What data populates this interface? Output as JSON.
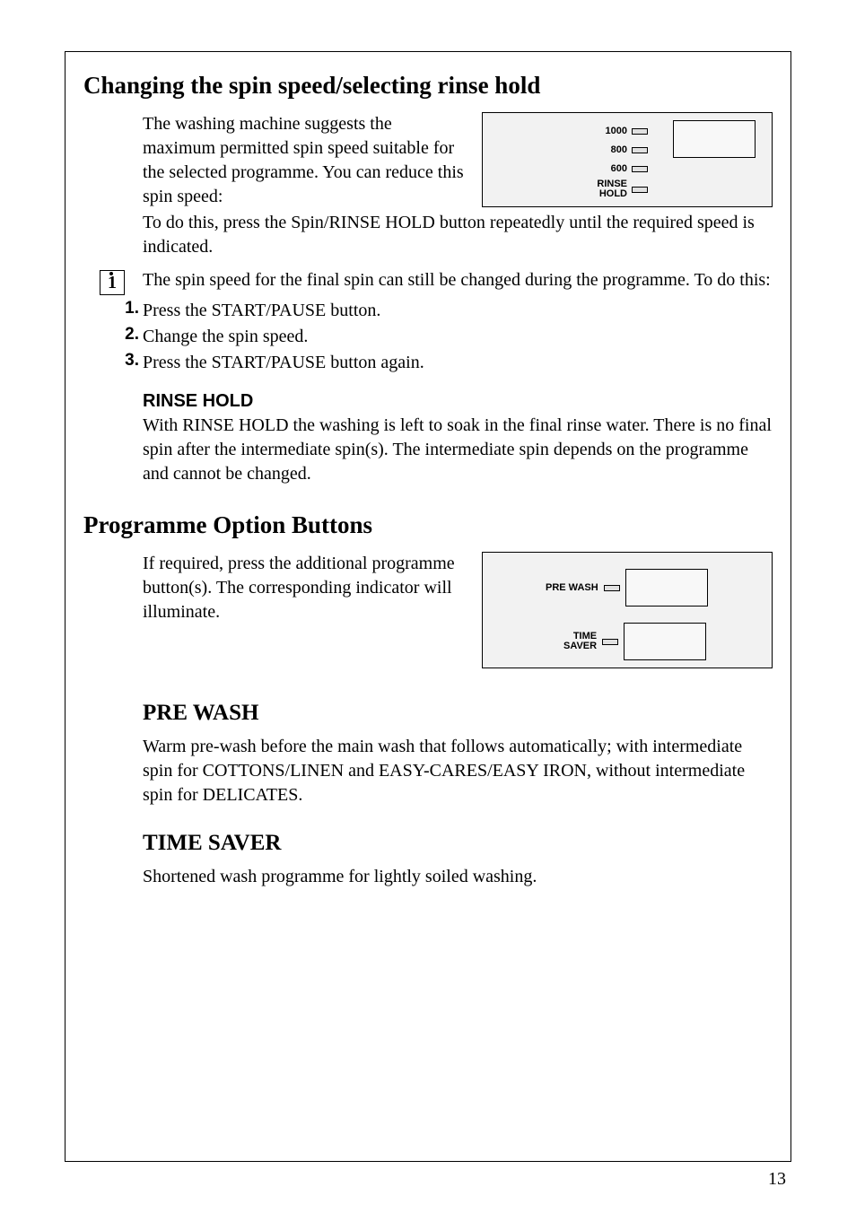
{
  "page": {
    "number": "13"
  },
  "sections": {
    "spin": {
      "heading": "Changing the spin speed/selecting rinse hold",
      "para1": "The washing machine suggests the maximum permitted spin speed suitable for the selected programme. You can reduce this spin speed:",
      "para2": "To do this, press the Spin/RINSE HOLD button repeatedly until the required speed is indicated.",
      "info_text": "The spin speed for the final spin can still be changed during the programme. To do this:",
      "steps": [
        "Press the START/PAUSE button.",
        "Change the spin speed.",
        "Press the START/PAUSE button again."
      ],
      "rinse_hold_label": "RINSE HOLD",
      "rinse_hold_text": "With RINSE HOLD the washing is left to soak in the final rinse water. There is no final spin after the intermediate spin(s). The intermediate spin depends on the programme and cannot be changed.",
      "panel": {
        "l1": "1000",
        "l2": "800",
        "l3": "600",
        "l4a": "RINSE",
        "l4b": "HOLD"
      }
    },
    "options": {
      "heading": "Programme Option Buttons",
      "para": "If required, press the additional programme button(s). The corresponding indicator will illuminate.",
      "panel": {
        "prewash": "PRE WASH",
        "timesaver_a": "TIME",
        "timesaver_b": "SAVER"
      }
    },
    "prewash": {
      "heading": "PRE WASH",
      "text": "Warm pre-wash before the main wash that follows automatically; with intermediate spin for COTTONS/LINEN and EASY-CARES/EASY IRON, without intermediate spin for DELICATES."
    },
    "timesaver": {
      "heading": "TIME SAVER",
      "text": "Shortened wash programme for lightly soiled washing."
    }
  }
}
